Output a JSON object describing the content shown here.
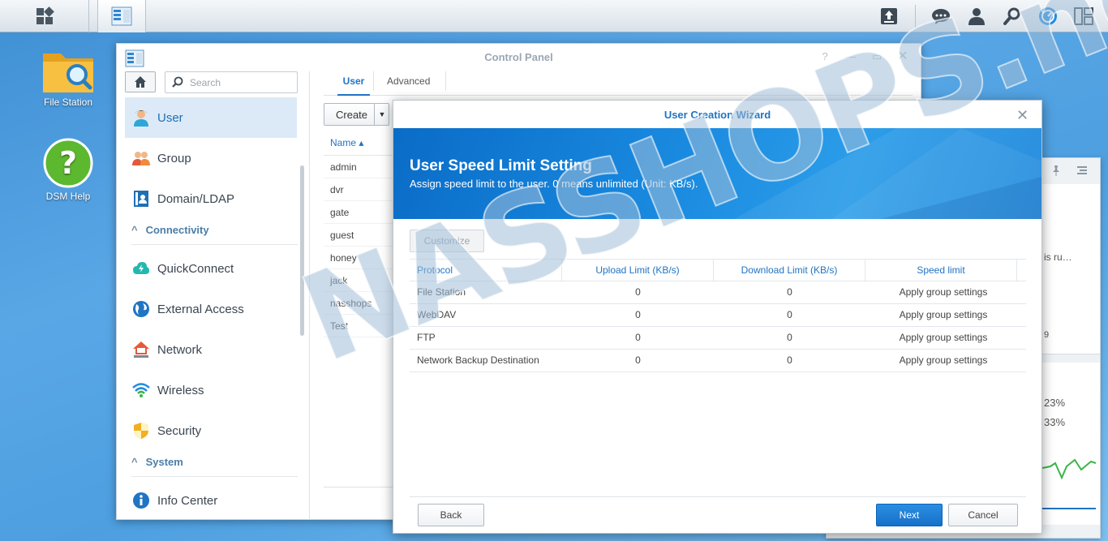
{
  "desktop": {
    "icons": [
      {
        "label": "File Station"
      },
      {
        "label": "DSM Help"
      }
    ]
  },
  "control_panel": {
    "title": "Control Panel",
    "search_placeholder": "Search",
    "nav": {
      "user": "User",
      "group": "Group",
      "domain": "Domain/LDAP",
      "connectivity_section": "Connectivity",
      "quickconnect": "QuickConnect",
      "external_access": "External Access",
      "network": "Network",
      "wireless": "Wireless",
      "security": "Security",
      "system_section": "System",
      "info_center": "Info Center"
    },
    "tabs": {
      "user": "User",
      "advanced": "Advanced"
    },
    "create_label": "Create",
    "user_list": {
      "header": "Name ▴",
      "rows": [
        "admin",
        "dvr",
        "gate",
        "guest",
        "honey",
        "jack",
        "nasshops",
        "Test"
      ]
    }
  },
  "widget": {
    "text_1": "is ru…",
    "text_2": "9",
    "cpu": "23%",
    "ram": "33%"
  },
  "wizard": {
    "title": "User Creation Wizard",
    "heading": "User Speed Limit Setting",
    "subheading": "Assign speed limit to the user. 0 means unlimited (Unit: KB/s).",
    "customize_label": "Customize",
    "columns": {
      "protocol": "Protocol",
      "upload": "Upload Limit (KB/s)",
      "download": "Download Limit (KB/s)",
      "speed": "Speed limit"
    },
    "rows": [
      {
        "protocol": "File Station",
        "upload": "0",
        "download": "0",
        "speed": "Apply group settings"
      },
      {
        "protocol": "WebDAV",
        "upload": "0",
        "download": "0",
        "speed": "Apply group settings"
      },
      {
        "protocol": "FTP",
        "upload": "0",
        "download": "0",
        "speed": "Apply group settings"
      },
      {
        "protocol": "Network Backup Destination",
        "upload": "0",
        "download": "0",
        "speed": "Apply group settings"
      }
    ],
    "back_label": "Back",
    "next_label": "Next",
    "cancel_label": "Cancel"
  },
  "watermark": "NASSHOPS.net",
  "colors": {
    "accent": "#1f74c4",
    "banner": "#1a8be0",
    "active_nav": "#dceaf7"
  }
}
